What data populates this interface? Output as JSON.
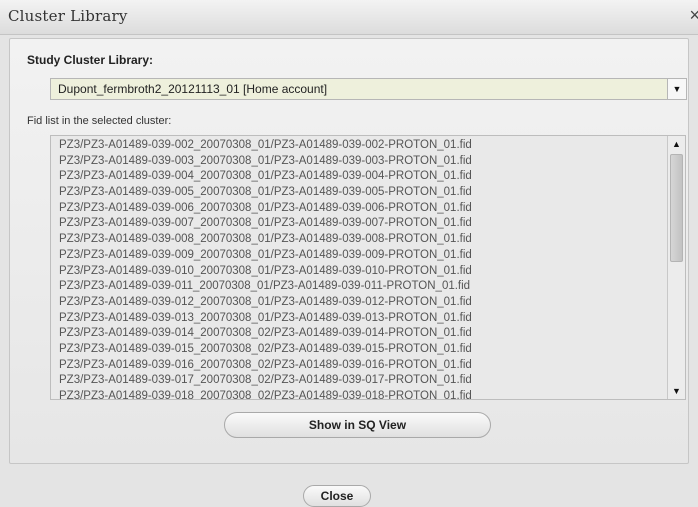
{
  "window": {
    "title": "Cluster Library",
    "close_glyph": "×"
  },
  "study": {
    "label": "Study Cluster Library:",
    "selected": "Dupont_fermbroth2_20121113_01 [Home account]"
  },
  "fid_list": {
    "label": "Fid list in the selected cluster:",
    "items": [
      "PZ3/PZ3-A01489-039-002_20070308_01/PZ3-A01489-039-002-PROTON_01.fid",
      "PZ3/PZ3-A01489-039-003_20070308_01/PZ3-A01489-039-003-PROTON_01.fid",
      "PZ3/PZ3-A01489-039-004_20070308_01/PZ3-A01489-039-004-PROTON_01.fid",
      "PZ3/PZ3-A01489-039-005_20070308_01/PZ3-A01489-039-005-PROTON_01.fid",
      "PZ3/PZ3-A01489-039-006_20070308_01/PZ3-A01489-039-006-PROTON_01.fid",
      "PZ3/PZ3-A01489-039-007_20070308_01/PZ3-A01489-039-007-PROTON_01.fid",
      "PZ3/PZ3-A01489-039-008_20070308_01/PZ3-A01489-039-008-PROTON_01.fid",
      "PZ3/PZ3-A01489-039-009_20070308_01/PZ3-A01489-039-009-PROTON_01.fid",
      "PZ3/PZ3-A01489-039-010_20070308_01/PZ3-A01489-039-010-PROTON_01.fid",
      "PZ3/PZ3-A01489-039-011_20070308_01/PZ3-A01489-039-011-PROTON_01.fid",
      "PZ3/PZ3-A01489-039-012_20070308_01/PZ3-A01489-039-012-PROTON_01.fid",
      "PZ3/PZ3-A01489-039-013_20070308_01/PZ3-A01489-039-013-PROTON_01.fid",
      "PZ3/PZ3-A01489-039-014_20070308_02/PZ3-A01489-039-014-PROTON_01.fid",
      "PZ3/PZ3-A01489-039-015_20070308_02/PZ3-A01489-039-015-PROTON_01.fid",
      "PZ3/PZ3-A01489-039-016_20070308_02/PZ3-A01489-039-016-PROTON_01.fid",
      "PZ3/PZ3-A01489-039-017_20070308_02/PZ3-A01489-039-017-PROTON_01.fid",
      "PZ3/PZ3-A01489-039-018_20070308_02/PZ3-A01489-039-018-PROTON_01.fid"
    ]
  },
  "icons": {
    "dropdown": "▼",
    "scroll_up": "▲",
    "scroll_down": "▼"
  },
  "buttons": {
    "show_sq_view": "Show in SQ View",
    "close": "Close"
  }
}
